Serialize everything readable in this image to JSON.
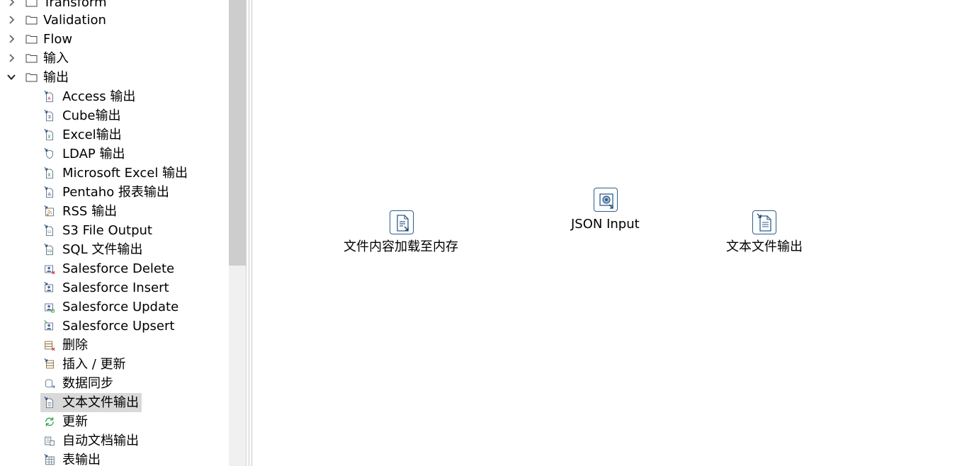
{
  "tree": {
    "categories": [
      {
        "label": "Transform",
        "expanded": false
      },
      {
        "label": "Validation",
        "expanded": false
      },
      {
        "label": "Flow",
        "expanded": false
      },
      {
        "label": "输入",
        "expanded": false
      },
      {
        "label": "输出",
        "expanded": true
      }
    ],
    "output_items": [
      {
        "label": "Access 输出",
        "icon": "access-output-icon",
        "selected": false
      },
      {
        "label": "Cube输出",
        "icon": "cube-output-icon",
        "selected": false
      },
      {
        "label": "Excel输出",
        "icon": "excel-output-icon",
        "selected": false
      },
      {
        "label": "LDAP 输出",
        "icon": "ldap-output-icon",
        "selected": false
      },
      {
        "label": "Microsoft Excel 输出",
        "icon": "microsoft-excel-output-icon",
        "selected": false
      },
      {
        "label": "Pentaho 报表输出",
        "icon": "pentaho-report-output-icon",
        "selected": false
      },
      {
        "label": "RSS 输出",
        "icon": "rss-output-icon",
        "selected": false
      },
      {
        "label": "S3 File Output",
        "icon": "s3-file-output-icon",
        "selected": false
      },
      {
        "label": "SQL 文件输出",
        "icon": "sql-file-output-icon",
        "selected": false
      },
      {
        "label": "Salesforce Delete",
        "icon": "salesforce-delete-icon",
        "selected": false
      },
      {
        "label": "Salesforce Insert",
        "icon": "salesforce-insert-icon",
        "selected": false
      },
      {
        "label": "Salesforce Update",
        "icon": "salesforce-update-icon",
        "selected": false
      },
      {
        "label": "Salesforce Upsert",
        "icon": "salesforce-upsert-icon",
        "selected": false
      },
      {
        "label": "删除",
        "icon": "delete-icon",
        "selected": false
      },
      {
        "label": "插入 / 更新",
        "icon": "insert-update-icon",
        "selected": false
      },
      {
        "label": "数据同步",
        "icon": "data-sync-icon",
        "selected": false
      },
      {
        "label": "文本文件输出",
        "icon": "text-file-output-icon",
        "selected": true
      },
      {
        "label": "更新",
        "icon": "update-icon",
        "selected": false
      },
      {
        "label": "自动文档输出",
        "icon": "auto-doc-output-icon",
        "selected": false
      },
      {
        "label": "表输出",
        "icon": "table-output-icon",
        "selected": false
      }
    ]
  },
  "canvas": {
    "steps": [
      {
        "name": "文件内容加载至内存",
        "icon": "load-file-content-icon"
      },
      {
        "name": "JSON Input",
        "icon": "json-input-icon"
      },
      {
        "name": "文本文件输出",
        "icon": "text-file-output-step-icon"
      }
    ]
  },
  "colors": {
    "selection": "#d9d9d9",
    "step_border": "#2f5d8a",
    "scroll_thumb": "#cdcdcd",
    "update_green": "#2ea043"
  }
}
